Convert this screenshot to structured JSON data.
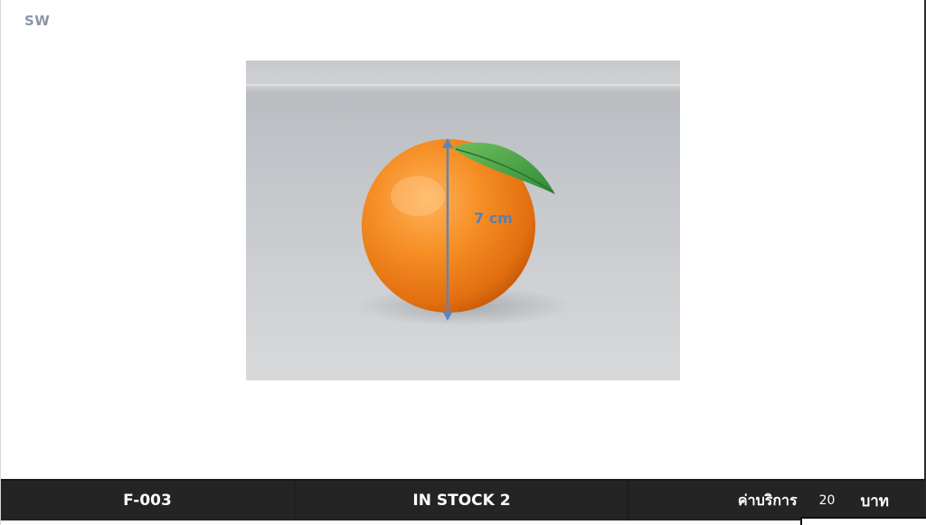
{
  "header": {
    "logo_text": "SW"
  },
  "product": {
    "image_label": "7 cm"
  },
  "footer": {
    "code": "F-003",
    "stock": "IN  STOCK  2",
    "fee_label": "ค่าบริการ",
    "fee_value": "20",
    "fee_unit": "บาท"
  }
}
